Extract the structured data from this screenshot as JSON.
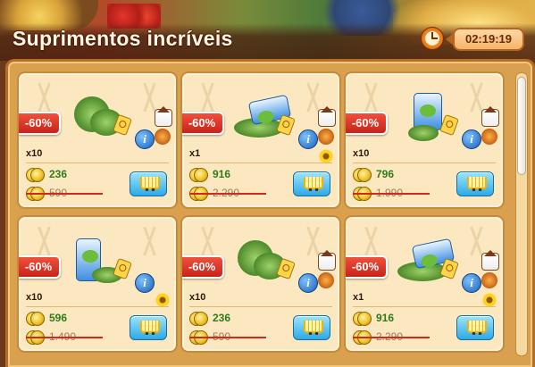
{
  "header": {
    "title": "Suprimentos incríveis",
    "timer": "02:19:19"
  },
  "cards": [
    {
      "discount": "-60%",
      "qty": "x10",
      "price_new": "236",
      "price_old": "590",
      "badges": [
        "house-icon",
        "food-icon"
      ],
      "item": "herbs-bundle-icon"
    },
    {
      "discount": "-60%",
      "qty": "x1",
      "price_new": "916",
      "price_old": "2.290",
      "badges": [
        "house-icon",
        "food-icon",
        "flower-icon"
      ],
      "item": "beans-pile-icon"
    },
    {
      "discount": "-60%",
      "qty": "x10",
      "price_new": "796",
      "price_old": "1.990",
      "badges": [
        "house-icon",
        "food-icon"
      ],
      "item": "seed-bag-icon"
    },
    {
      "discount": "-60%",
      "qty": "x10",
      "price_new": "596",
      "price_old": "1.490",
      "badges": [
        "flower-icon"
      ],
      "item": "fertilizer-bottle-icon"
    },
    {
      "discount": "-60%",
      "qty": "x10",
      "price_new": "236",
      "price_old": "590",
      "badges": [
        "house-icon",
        "food-icon"
      ],
      "item": "herbs-bundle-icon"
    },
    {
      "discount": "-60%",
      "qty": "x1",
      "price_new": "916",
      "price_old": "2.290",
      "badges": [
        "house-icon",
        "food-icon",
        "flower-icon"
      ],
      "item": "beans-pile-icon"
    }
  ],
  "colors": {
    "discount": "#d1291d",
    "price_new": "#2e7d1a",
    "price_old": "#a07a56",
    "timer_bg": "#f6b46a"
  }
}
